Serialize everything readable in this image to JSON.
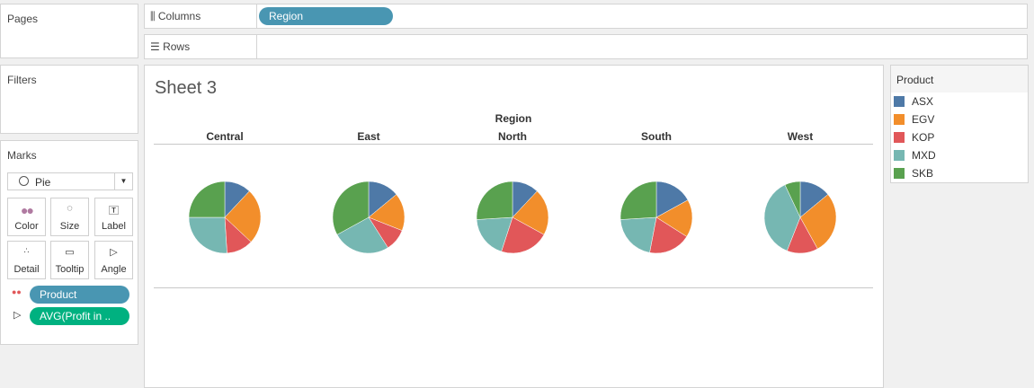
{
  "pages": {
    "title": "Pages"
  },
  "filters": {
    "title": "Filters"
  },
  "marks": {
    "title": "Marks",
    "type": "Pie",
    "cards": [
      "Color",
      "Size",
      "Label",
      "Detail",
      "Tooltip",
      "Angle"
    ],
    "pills": [
      "Product",
      "AVG(Profit in .."
    ]
  },
  "columns": {
    "label": "Columns",
    "pill": "Region"
  },
  "rows": {
    "label": "Rows"
  },
  "sheet": {
    "title": "Sheet 3"
  },
  "legend": {
    "title": "Product",
    "items": [
      {
        "name": "ASX",
        "color": "#4e79a7"
      },
      {
        "name": "EGV",
        "color": "#f28e2b"
      },
      {
        "name": "KOP",
        "color": "#e15759"
      },
      {
        "name": "MXD",
        "color": "#76b7b2"
      },
      {
        "name": "SKB",
        "color": "#59a14f"
      }
    ]
  },
  "chart_data": {
    "type": "pie",
    "header": "Region",
    "categories": [
      "Central",
      "East",
      "North",
      "South",
      "West"
    ],
    "slice_order": [
      "ASX",
      "EGV",
      "KOP",
      "MXD",
      "SKB"
    ],
    "unit": "percent of pie",
    "series": [
      {
        "name": "Central",
        "values": [
          12,
          25,
          12,
          26,
          25
        ]
      },
      {
        "name": "East",
        "values": [
          14,
          17,
          10,
          26,
          33
        ]
      },
      {
        "name": "North",
        "values": [
          12,
          21,
          22,
          19,
          26
        ]
      },
      {
        "name": "South",
        "values": [
          17,
          17,
          19,
          21,
          26
        ]
      },
      {
        "name": "West",
        "values": [
          14,
          28,
          14,
          37,
          7
        ]
      }
    ]
  }
}
